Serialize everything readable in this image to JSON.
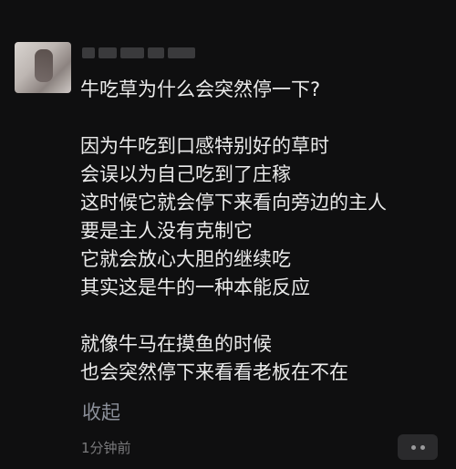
{
  "post": {
    "lines": [
      "牛吃草为什么会突然停一下?",
      "",
      "因为牛吃到口感特别好的草时",
      "会误以为自己吃到了庄稼",
      "这时候它就会停下来看向旁边的主人",
      "要是主人没有克制它",
      "它就会放心大胆的继续吃",
      "其实这是牛的一种本能反应",
      "",
      "就像牛马在摸鱼的时候",
      "也会突然停下来看看老板在不在"
    ],
    "collapse_label": "收起",
    "timestamp": "1分钟前"
  },
  "icons": {
    "more": "more-dots-icon"
  }
}
